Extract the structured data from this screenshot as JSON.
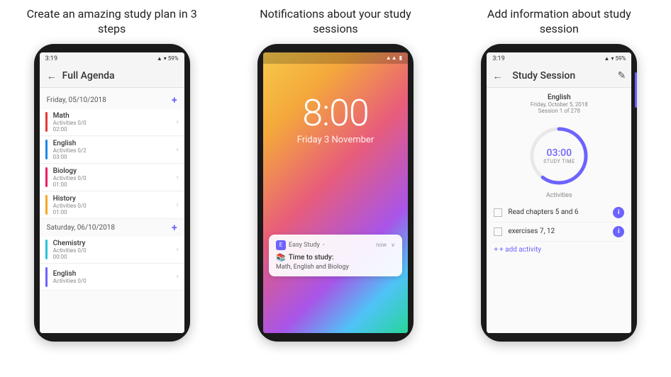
{
  "panels": [
    {
      "id": "agenda",
      "title": "Create an amazing study plan in 3 steps",
      "screen": {
        "statusBar": {
          "time": "3:19",
          "battery": "59%"
        },
        "toolbar": {
          "title": "Full Agenda",
          "backLabel": "←"
        },
        "sections": [
          {
            "date": "Friday, 05/10/2018",
            "items": [
              {
                "name": "Math",
                "sub1": "Activities 0/0",
                "sub2": "02:00",
                "color": "#e53935"
              },
              {
                "name": "English",
                "sub1": "Activities 0/2",
                "sub2": "03:00",
                "color": "#1e88e5"
              },
              {
                "name": "Biology",
                "sub1": "Activities 0/0",
                "sub2": "01:00",
                "color": "#e91e63"
              },
              {
                "name": "History",
                "sub1": "Activities 0/0",
                "sub2": "01:00",
                "color": "#f9a825"
              }
            ]
          },
          {
            "date": "Saturday, 06/10/2018",
            "items": [
              {
                "name": "Chemistry",
                "sub1": "Activities 0/0",
                "sub2": "00:00",
                "color": "#26c6da"
              },
              {
                "name": "English",
                "sub1": "Activities 0/0",
                "sub2": "",
                "color": "#6c63ff"
              }
            ]
          }
        ]
      }
    },
    {
      "id": "notifications",
      "title": "Notifications about your study sessions",
      "lockScreen": {
        "time": "8:00",
        "date": "Friday 3 November",
        "notification": {
          "appName": "Easy Study",
          "timeAgo": "now",
          "title": "Time to study:",
          "body": "Math, English and Biology"
        }
      }
    },
    {
      "id": "study-session",
      "title": "Add information about study session",
      "screen": {
        "statusBar": {
          "time": "3:19",
          "battery": "59%"
        },
        "toolbar": {
          "title": "Study Session",
          "backLabel": "←",
          "editIcon": "✎"
        },
        "subject": "English",
        "date": "Friday, October 5, 2018",
        "session": "Session 1 of 278",
        "timer": {
          "time": "03:00",
          "label": "STUDY TIME"
        },
        "activitiesLabel": "Activities",
        "activities": [
          {
            "text": "Read chapters 5 and 6"
          },
          {
            "text": "exercises 7, 12"
          }
        ],
        "addActivityLabel": "+ add activity"
      }
    }
  ]
}
